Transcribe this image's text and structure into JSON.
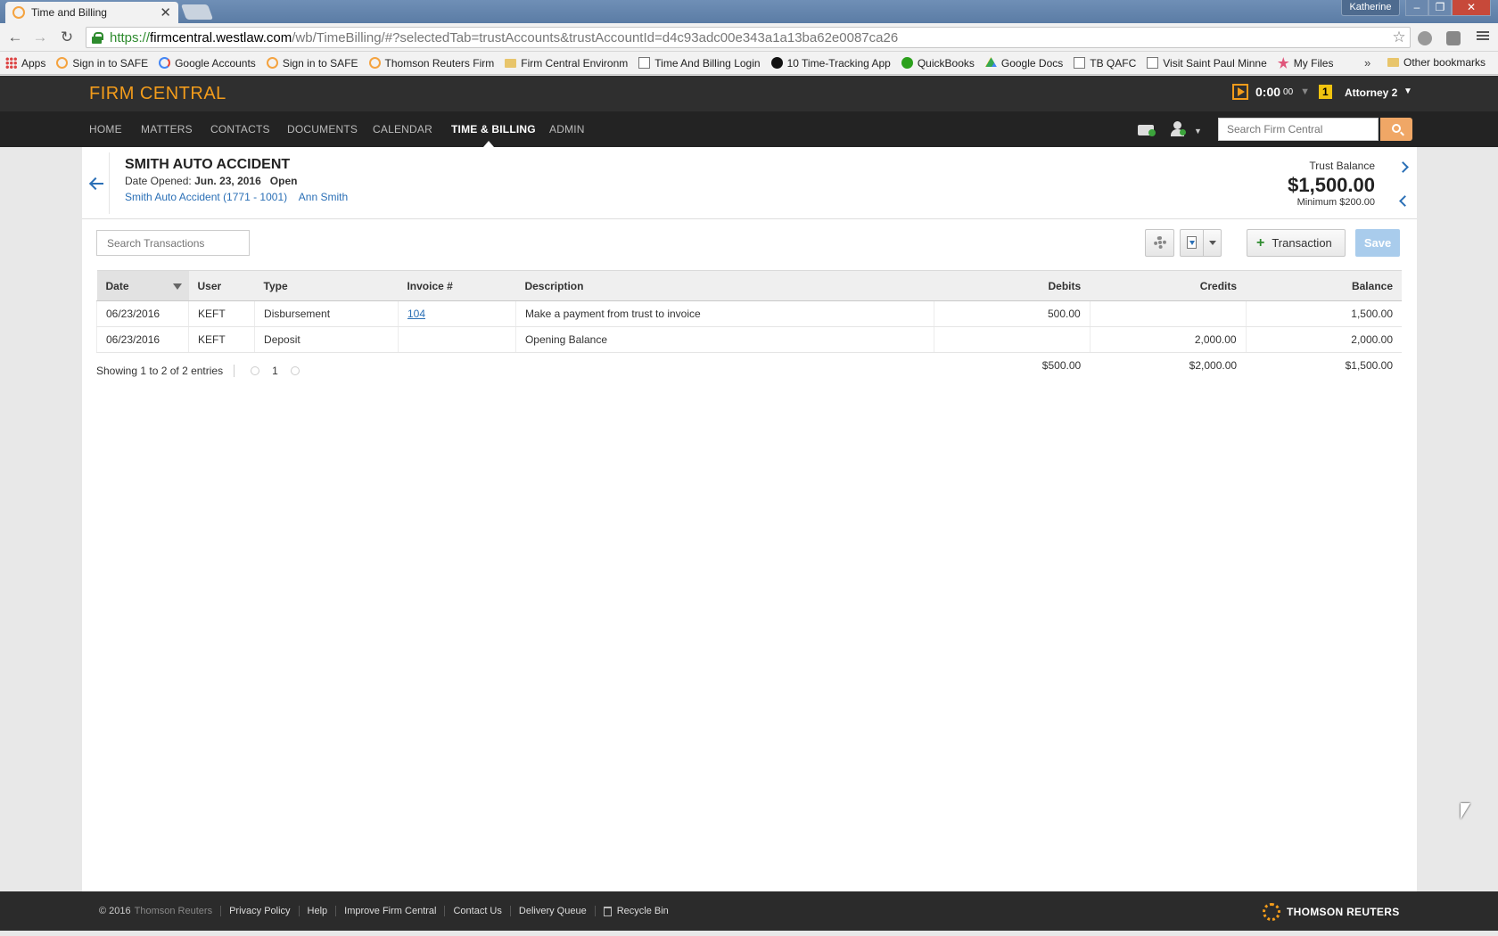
{
  "browser": {
    "tab_title": "Time and Billing",
    "tab_close": "✕",
    "profile": "Katherine",
    "url_scheme": "https://",
    "url_host": "firmcentral.westlaw.com",
    "url_path": "/wb/TimeBilling/#?selectedTab=trustAccounts&trustAccountId=d4c93adc00e343a1a13ba62e0087ca26",
    "bookmarks": [
      {
        "label": "Apps",
        "icon": "apps"
      },
      {
        "label": "Sign in to SAFE",
        "icon": "safe"
      },
      {
        "label": "Google Accounts",
        "icon": "g"
      },
      {
        "label": "Sign in to SAFE",
        "icon": "safe"
      },
      {
        "label": "Thomson Reuters Firm",
        "icon": "safe"
      },
      {
        "label": "Firm Central Environm",
        "icon": "folder"
      },
      {
        "label": "Time And Billing Login",
        "icon": "page"
      },
      {
        "label": "10 Time-Tracking App",
        "icon": "fc"
      },
      {
        "label": "QuickBooks",
        "icon": "qb"
      },
      {
        "label": "Google Docs",
        "icon": "gd"
      },
      {
        "label": "TB QAFC",
        "icon": "page"
      },
      {
        "label": "Visit Saint Paul Minne",
        "icon": "page"
      },
      {
        "label": "My Files",
        "icon": "star"
      }
    ],
    "bookmarks_more": "»",
    "other_bookmarks": "Other bookmarks"
  },
  "app": {
    "logo": "FIRM CENTRAL",
    "timer": {
      "time": "0:00",
      "seconds": "00",
      "count": "1"
    },
    "user": "Attorney 2",
    "nav": [
      "HOME",
      "MATTERS",
      "CONTACTS",
      "DOCUMENTS",
      "CALENDAR",
      "TIME & BILLING",
      "ADMIN"
    ],
    "search_placeholder": "Search Firm Central"
  },
  "matter": {
    "title": "SMITH AUTO ACCIDENT",
    "opened_label": "Date Opened:",
    "opened_date": "Jun. 23, 2016",
    "status": "Open",
    "matter_link": "Smith Auto Accident (1771 - 1001)",
    "client_link": "Ann Smith",
    "trust_label": "Trust Balance",
    "trust_amount": "$1,500.00",
    "trust_min": "Minimum $200.00"
  },
  "toolbar": {
    "search_placeholder": "Search Transactions",
    "add_label": "Transaction",
    "save_label": "Save"
  },
  "table": {
    "columns": [
      "Date",
      "User",
      "Type",
      "Invoice #",
      "Description",
      "Debits",
      "Credits",
      "Balance"
    ],
    "rows": [
      {
        "date": "06/23/2016",
        "user": "KEFT",
        "type": "Disbursement",
        "invoice": "104",
        "description": "Make a payment from trust to invoice",
        "debit": "500.00",
        "credit": "",
        "balance": "1,500.00"
      },
      {
        "date": "06/23/2016",
        "user": "KEFT",
        "type": "Deposit",
        "invoice": "",
        "description": "Opening Balance",
        "debit": "",
        "credit": "2,000.00",
        "balance": "2,000.00"
      }
    ],
    "totals": {
      "debit": "$500.00",
      "credit": "$2,000.00",
      "balance": "$1,500.00"
    }
  },
  "pager": {
    "summary": "Showing 1 to 2 of 2 entries",
    "page": "1"
  },
  "footer": {
    "copyright": "© 2016",
    "owner": "Thomson Reuters",
    "links": [
      "Privacy Policy",
      "Help",
      "Improve Firm Central",
      "Contact Us",
      "Delivery Queue"
    ],
    "recycle": "Recycle Bin",
    "brand": "THOMSON REUTERS"
  },
  "colors": {
    "brand_orange": "#f39c1b",
    "link_blue": "#2a6fb6",
    "debit_red": "#a32130",
    "credit_green": "#3f8a3f"
  }
}
